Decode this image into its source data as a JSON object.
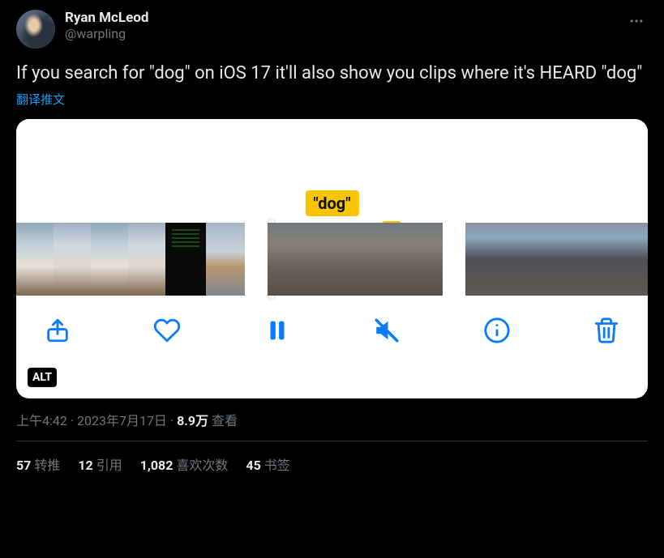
{
  "user": {
    "display_name": "Ryan McLeod",
    "handle": "@warpling"
  },
  "tweet": {
    "text": "If you search for \"dog\" on iOS 17 it'll also show you clips where it's HEARD \"dog\"",
    "translate_label": "翻译推文"
  },
  "media": {
    "search_highlight": "\"dog\"",
    "alt_badge": "ALT"
  },
  "meta": {
    "time": "上午4:42",
    "date": "2023年7月17日",
    "views_count": "8.9万",
    "views_label": "查看"
  },
  "stats": {
    "retweets_count": "57",
    "retweets_label": "转推",
    "quotes_count": "12",
    "quotes_label": "引用",
    "likes_count": "1,082",
    "likes_label": "喜欢次数",
    "bookmarks_count": "45",
    "bookmarks_label": "书签"
  }
}
